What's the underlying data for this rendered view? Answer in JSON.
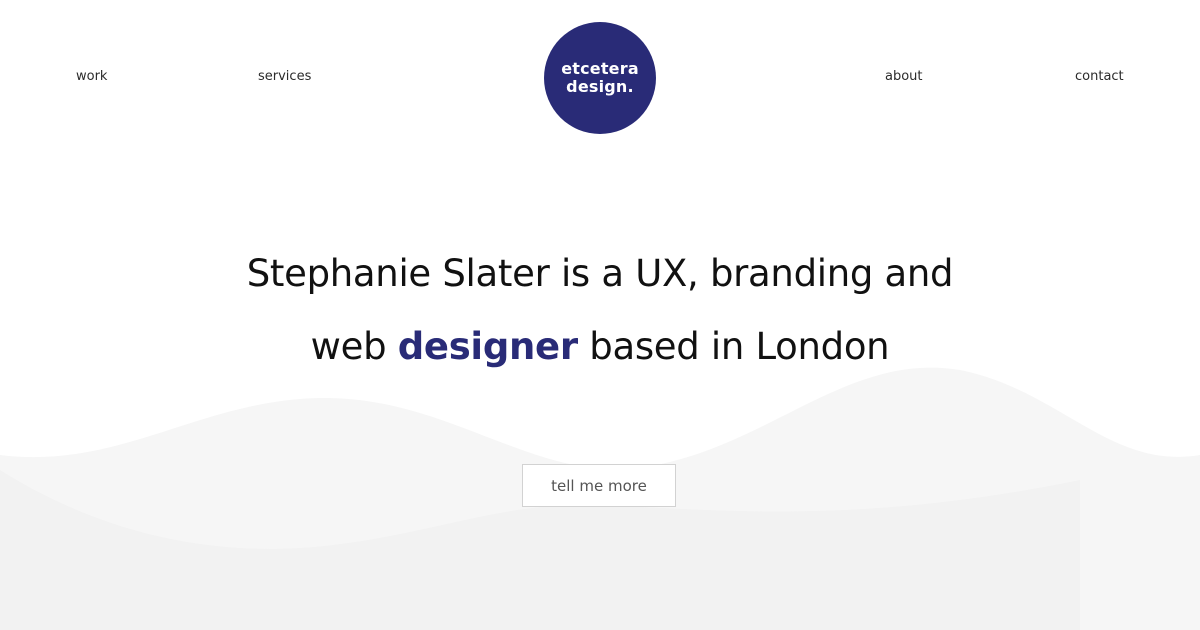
{
  "nav": {
    "work": "work",
    "services": "services",
    "about": "about",
    "contact": "contact"
  },
  "logo": {
    "line1": "etcetera",
    "line2": "design."
  },
  "hero": {
    "line1": "Stephanie Slater is a UX, branding and",
    "line2_before": "web ",
    "line2_highlight": "designer",
    "line2_after": " based in London"
  },
  "cta": {
    "label": "tell me more"
  },
  "colors": {
    "brand": "#292b77",
    "background": "#ffffff",
    "wave": "#f4f4f4"
  }
}
